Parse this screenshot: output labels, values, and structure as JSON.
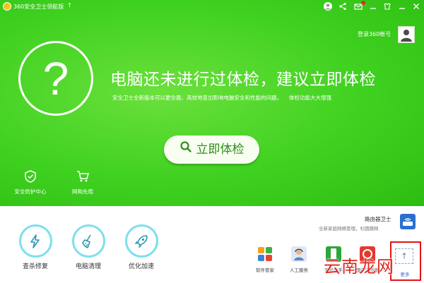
{
  "window": {
    "title": "360安全卫士领航版",
    "title_arrow": "↑"
  },
  "titlebar": {
    "icons": [
      "avatar-icon",
      "share-icon",
      "mail-icon",
      "minimize-icon",
      "skin-icon",
      "restore-icon",
      "close-icon"
    ]
  },
  "account": {
    "login_label": "登录360帐号"
  },
  "hero": {
    "headline": "电脑还未进行过体检，建议立即体检",
    "subline": "安全卫士全新版本可以更全面、高效地查出影响电脑安全和性能的问题，",
    "subline_link": "体检功能大大增强",
    "check_button": "立即体检"
  },
  "features": [
    {
      "label": "安全防护中心",
      "icon": "shield-icon"
    },
    {
      "label": "网购先赔",
      "icon": "cart-icon"
    }
  ],
  "tools": [
    {
      "label": "查杀修复",
      "icon": "lightning-icon"
    },
    {
      "label": "电脑清理",
      "icon": "broom-icon"
    },
    {
      "label": "优化加速",
      "icon": "rocket-icon"
    }
  ],
  "router": {
    "title": "路由器卫士",
    "subtitle": "全新家庭网络管理，杉圆蹭网"
  },
  "apps": [
    {
      "label": "软件管家",
      "icon": "software-manager-icon",
      "color": "#f2a11d"
    },
    {
      "label": "人工服务",
      "icon": "support-person-icon",
      "color": "#5f86c7"
    },
    {
      "label": "手机助手",
      "icon": "phone-icon",
      "color": "#2ea53a"
    },
    {
      "label": "国产浏览器",
      "icon": "browser-icon",
      "color": "#e23a2f"
    }
  ],
  "more": {
    "label": "更多"
  },
  "watermark": "云南龙网",
  "colors": {
    "hero_green": "#3fd120",
    "button_text": "#2e8d17",
    "tool_ring": "#7ee0ec",
    "highlight_red": "#e11414"
  }
}
